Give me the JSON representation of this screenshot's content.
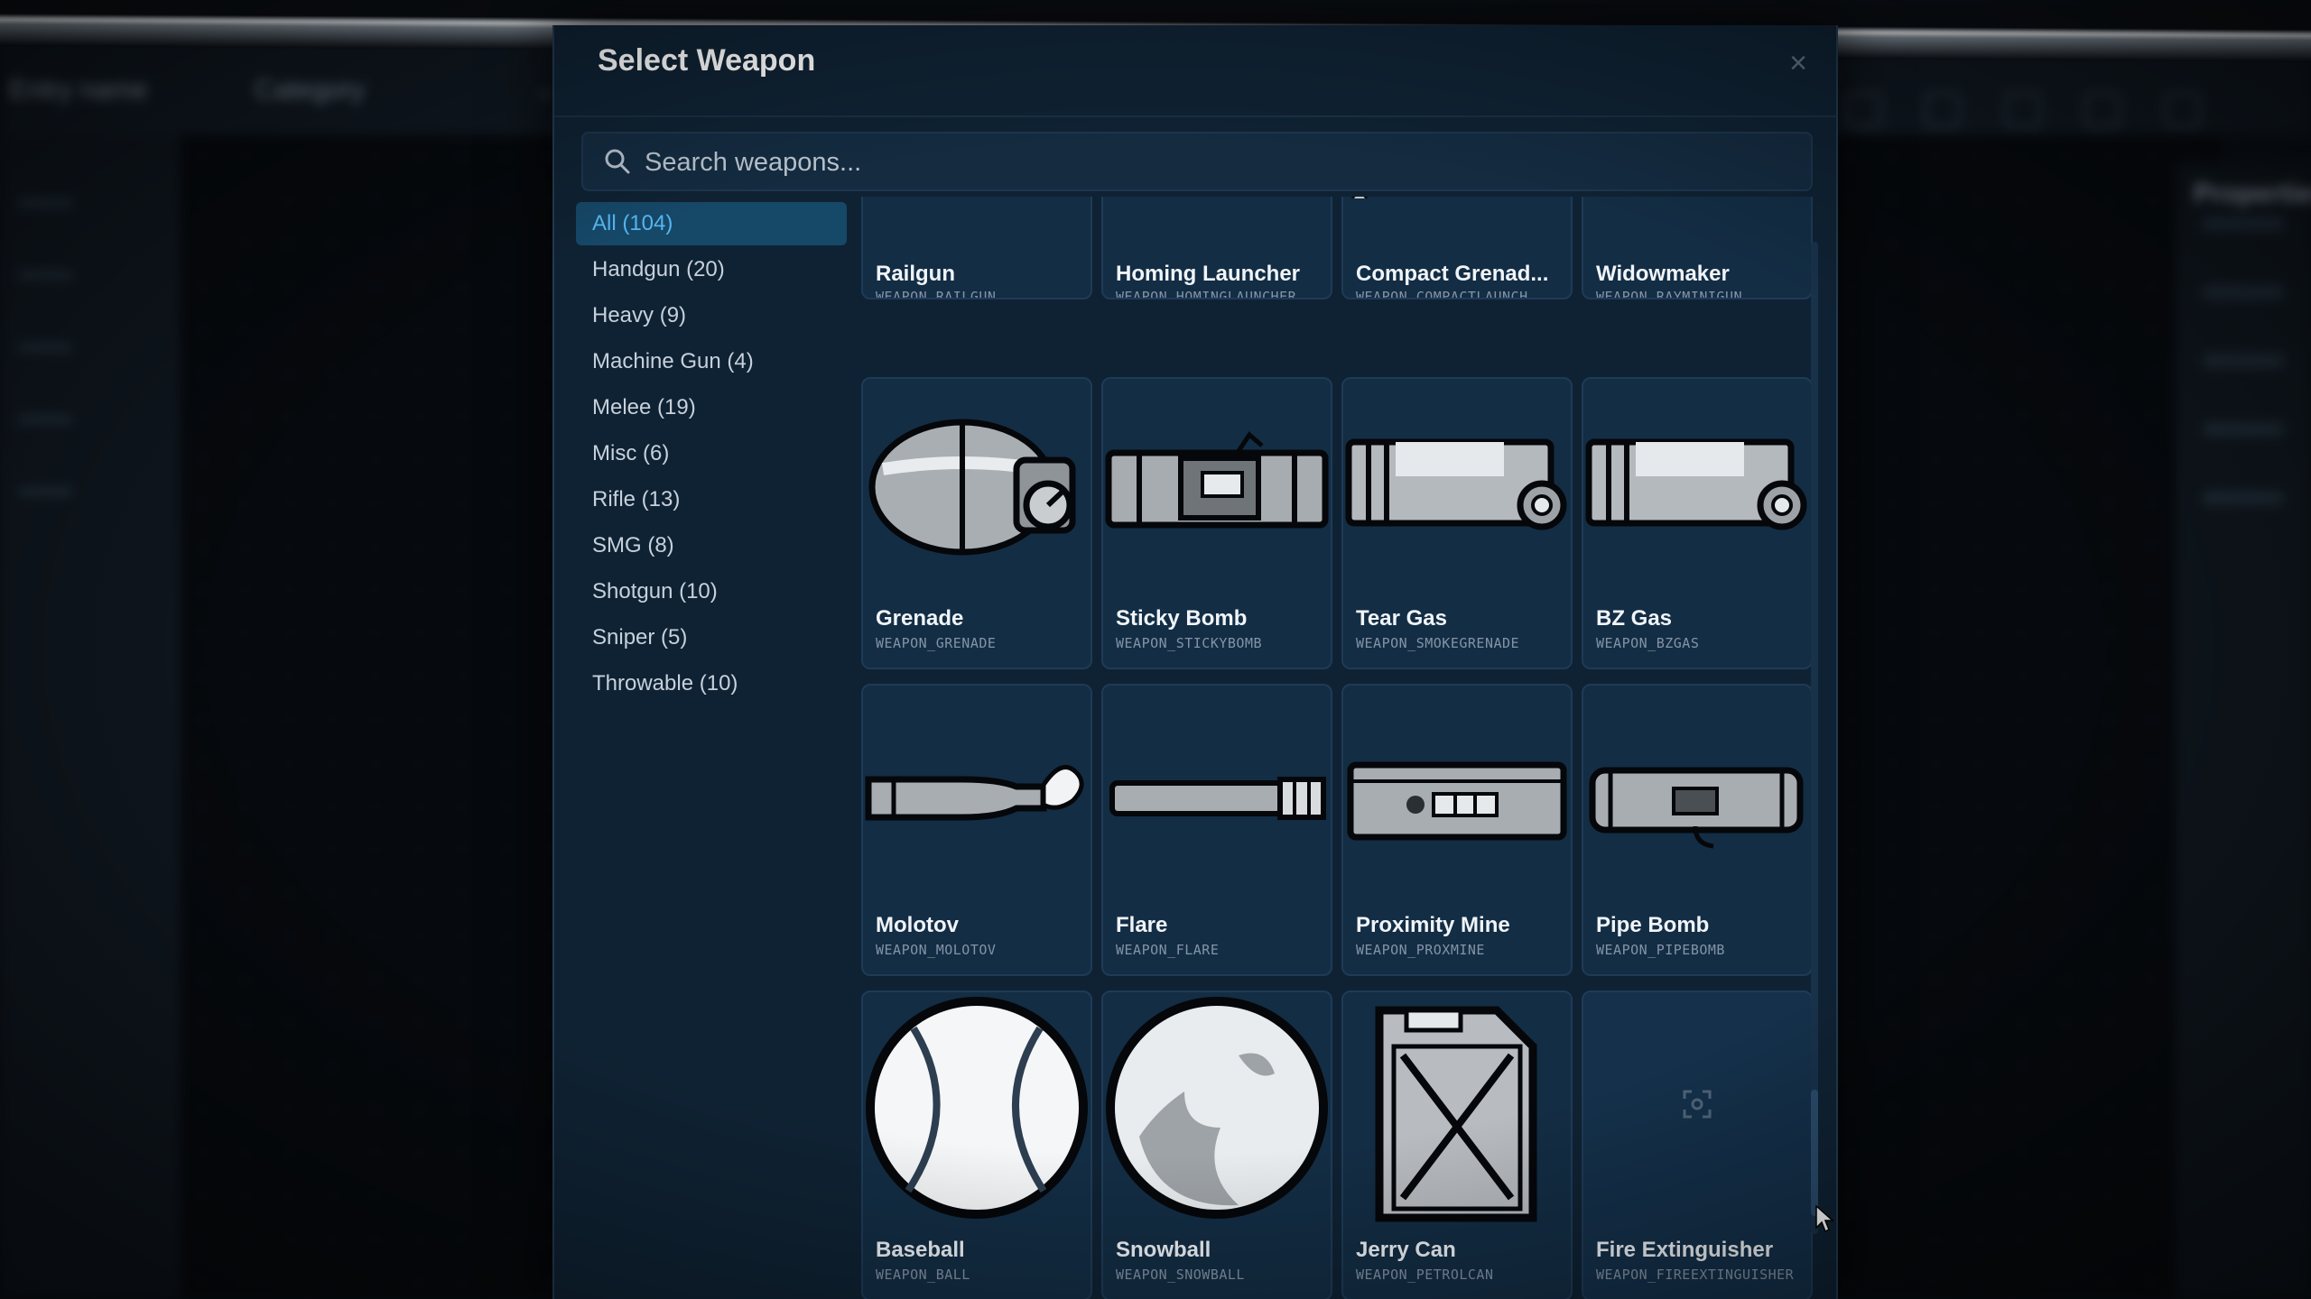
{
  "background": {
    "name_field": "Entry name",
    "category_select": "Category",
    "properties_title": "Properties"
  },
  "modal": {
    "title": "Select Weapon",
    "close_glyph": "×",
    "search": {
      "placeholder": "Search weapons..."
    },
    "categories": [
      {
        "label": "All (104)",
        "active": true
      },
      {
        "label": "Handgun (20)"
      },
      {
        "label": "Heavy (9)"
      },
      {
        "label": "Machine Gun (4)"
      },
      {
        "label": "Melee (19)"
      },
      {
        "label": "Misc (6)"
      },
      {
        "label": "Rifle (13)"
      },
      {
        "label": "SMG (8)"
      },
      {
        "label": "Shotgun (10)"
      },
      {
        "label": "Sniper (5)"
      },
      {
        "label": "Throwable (10)"
      }
    ],
    "weapons": [
      {
        "name": "Railgun",
        "code": "WEAPON_RAILGUN",
        "icon": "railgun-icon"
      },
      {
        "name": "Homing Launcher",
        "code": "WEAPON_HOMINGLAUNCHER",
        "icon": "homing-launcher-icon"
      },
      {
        "name": "Compact Grenad...",
        "code": "WEAPON_COMPACTLAUNCH...",
        "icon": "compact-launcher-icon"
      },
      {
        "name": "Widowmaker",
        "code": "WEAPON_RAYMINIGUN",
        "icon": "widowmaker-icon"
      },
      {
        "name": "Grenade",
        "code": "WEAPON_GRENADE",
        "icon": "grenade-icon"
      },
      {
        "name": "Sticky Bomb",
        "code": "WEAPON_STICKYBOMB",
        "icon": "sticky-bomb-icon"
      },
      {
        "name": "Tear Gas",
        "code": "WEAPON_SMOKEGRENADE",
        "icon": "tear-gas-icon"
      },
      {
        "name": "BZ Gas",
        "code": "WEAPON_BZGAS",
        "icon": "bz-gas-icon"
      },
      {
        "name": "Molotov",
        "code": "WEAPON_MOLOTOV",
        "icon": "molotov-icon"
      },
      {
        "name": "Flare",
        "code": "WEAPON_FLARE",
        "icon": "flare-icon"
      },
      {
        "name": "Proximity Mine",
        "code": "WEAPON_PROXMINE",
        "icon": "proximity-mine-icon"
      },
      {
        "name": "Pipe Bomb",
        "code": "WEAPON_PIPEBOMB",
        "icon": "pipe-bomb-icon"
      },
      {
        "name": "Baseball",
        "code": "WEAPON_BALL",
        "icon": "baseball-icon"
      },
      {
        "name": "Snowball",
        "code": "WEAPON_SNOWBALL",
        "icon": "snowball-icon"
      },
      {
        "name": "Jerry Can",
        "code": "WEAPON_PETROLCAN",
        "icon": "jerry-can-icon"
      },
      {
        "name": "Fire Extinguisher",
        "code": "WEAPON_FIREEXTINGUISHER",
        "icon": "image-placeholder-icon"
      }
    ]
  },
  "colors": {
    "accent": "#56b6f2",
    "active_bg": "#164868",
    "modal_bg": "#0f2233",
    "card_bg": "#132d44"
  }
}
